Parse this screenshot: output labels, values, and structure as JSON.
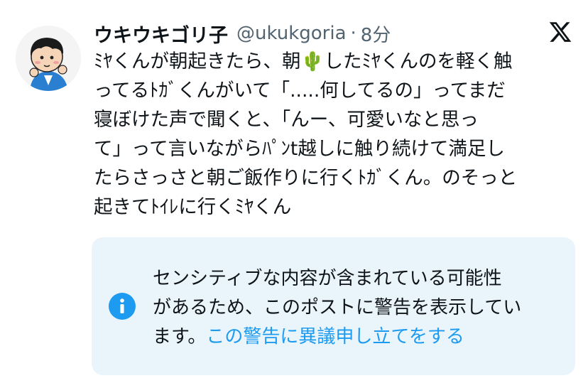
{
  "tweet": {
    "author": {
      "display_name": "ウキウキゴリ子",
      "handle": "@ukukgoria",
      "separator": "·",
      "time": "8分"
    },
    "logo_icon": "x-logo-icon",
    "avatar_icon": "avatar-cartoon",
    "body_lines": [
      "ﾐﾔくんが朝起きたら、朝🌵したﾐﾔくんのを軽く触",
      "ってるﾄｶﾞくんがいて「.....何してるの」ってまだ",
      "寝ぼけた声で聞くと、「んー、可愛いなと思っ",
      "て」って言いながらﾊﾟﾝt越しに触り続けて満足し",
      "たらさっさと朝ご飯作りに行くﾄｶﾞくん。のそっと",
      "起きてﾄｲﾚに行くﾐﾔくん"
    ]
  },
  "warning": {
    "icon": "info-icon",
    "line1": "センシティブな内容が含まれている可能性",
    "line2": "があるため、このポストに警告を表示してい",
    "line3_prefix": "ます。",
    "link_text": "この警告に異議申し立てをする",
    "colors": {
      "background": "#eaf4fb",
      "link": "#1d9bf0",
      "icon": "#1d9bf0"
    }
  }
}
